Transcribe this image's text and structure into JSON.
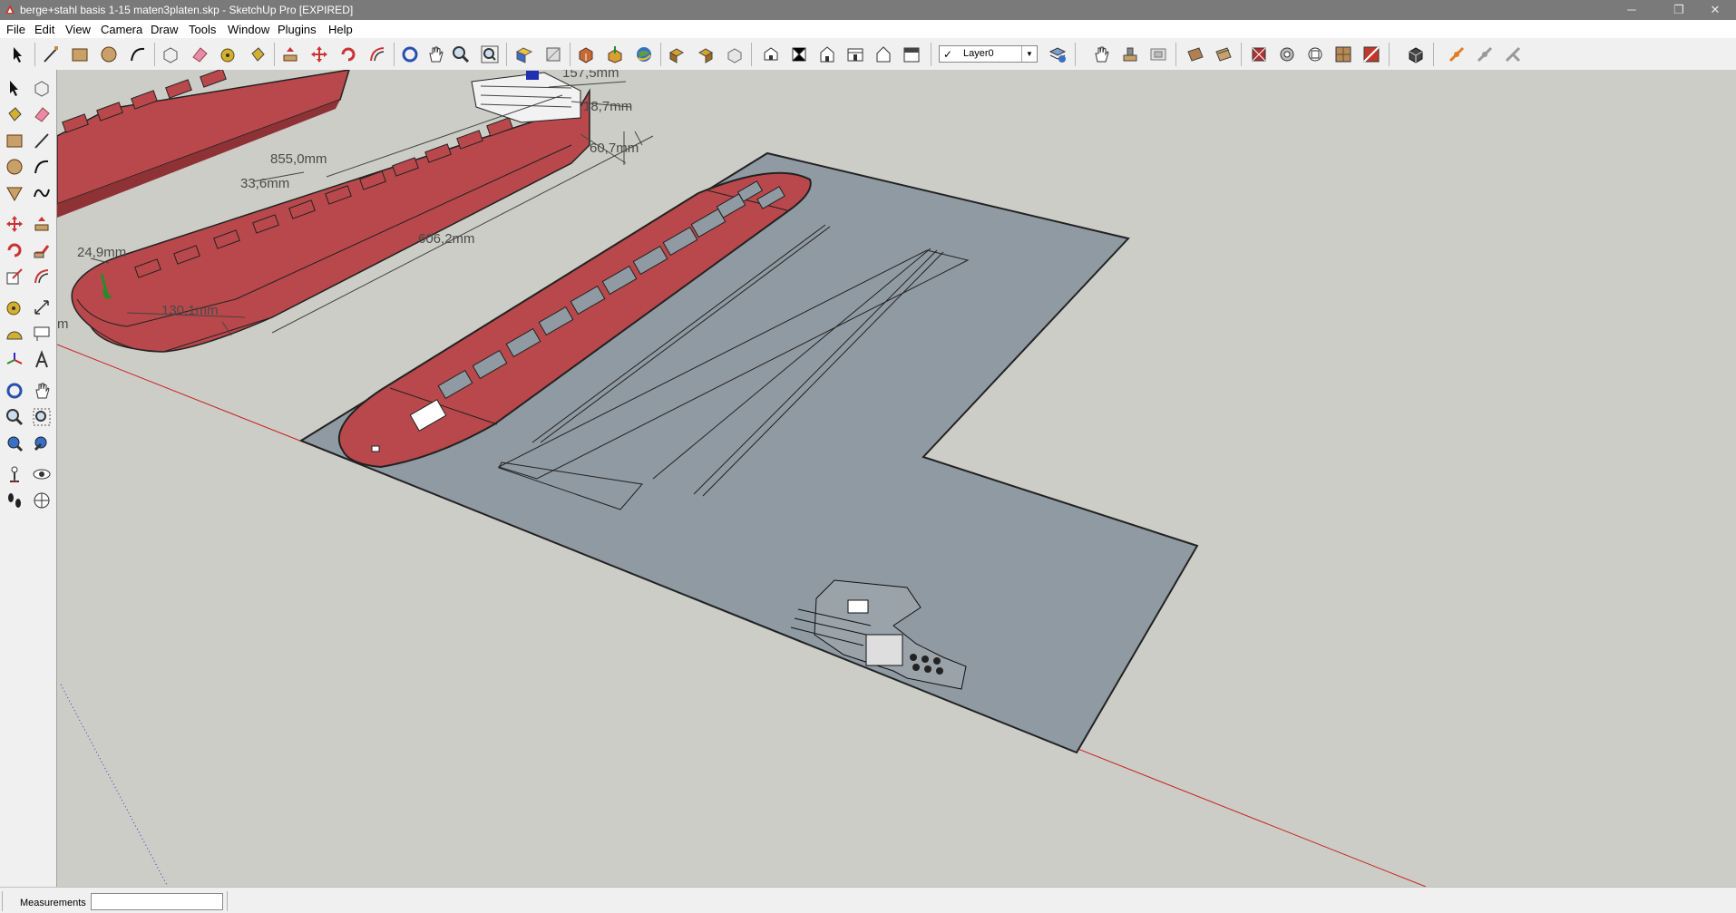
{
  "window": {
    "title": "berge+stahl basis 1-15 maten3platen.skp - SketchUp Pro [EXPIRED]",
    "minimize_glyph": "─",
    "restore_glyph": "❐",
    "close_glyph": "✕"
  },
  "menu": [
    "File",
    "Edit",
    "View",
    "Camera",
    "Draw",
    "Tools",
    "Window",
    "Plugins",
    "Help"
  ],
  "layer": {
    "check": "✓",
    "name": "Layer0",
    "arrow": "▼"
  },
  "dimensions": {
    "d1": "157,5mm",
    "d2": "18,7mm",
    "d3": "60,7mm",
    "d4": "855,0mm",
    "d5": "33,6mm",
    "d6": "606,2mm",
    "d7": "24,9mm",
    "d8": "130,1mm",
    "d9": "m"
  },
  "status": {
    "measurements_label": "Measurements",
    "measurements_value": ""
  },
  "colors": {
    "hull": "#b8484b",
    "hull_dark": "#8e3236",
    "plate": "#8f9aa2",
    "ground": "#cdcdc8",
    "red_axis": "#d02020",
    "green_axis": "#2a8a2a",
    "blue_axis": "#3030c0"
  },
  "icons": {
    "toolbar": [
      "select-icon",
      "line-icon",
      "rectangle-icon",
      "circle-icon",
      "arc-icon",
      "make-component-icon",
      "eraser-icon",
      "tape-measure-icon",
      "paint-bucket-icon",
      "push-pull-icon",
      "move-icon",
      "rotate-icon",
      "offset-icon",
      "orbit-icon",
      "pan-icon",
      "zoom-icon",
      "zoom-extents-icon",
      "previous-view-icon",
      "next-view-icon",
      "3d-warehouse-icon",
      "share-model-icon",
      "google-earth-icon",
      "get-models-icon",
      "share-component-icon",
      "extension-warehouse-icon",
      "iso-view-icon",
      "top-view-icon",
      "front-view-icon",
      "right-view-icon",
      "back-view-icon",
      "left-view-icon",
      "layer-manager-icon",
      "sandbox-icon",
      "stamp-icon",
      "drape-icon",
      "section-plane-icon",
      "section-cut-icon",
      "xray-icon",
      "back-edges-icon",
      "wireframe-icon",
      "hidden-line-icon",
      "shaded-icon",
      "shaded-textures-icon",
      "monochrome-icon",
      "scene-icon",
      "solid-tools-icon",
      "dynamic-components-icon",
      "interact-icon"
    ]
  }
}
